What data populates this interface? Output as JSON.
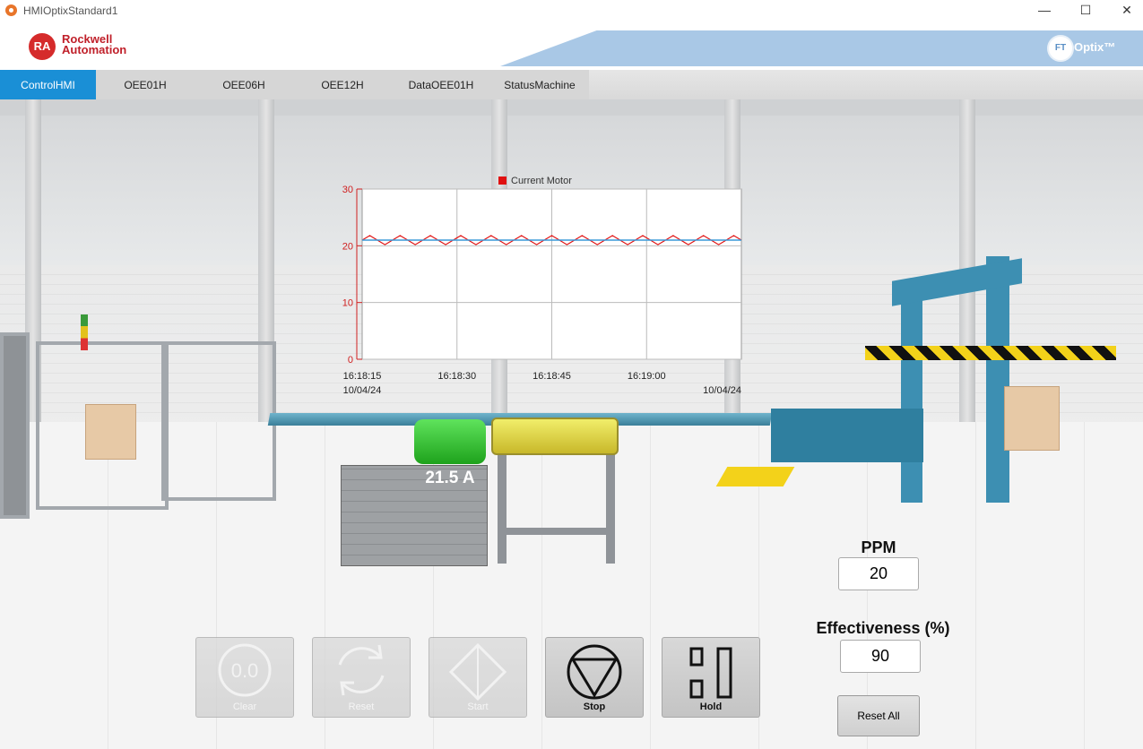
{
  "window": {
    "title": "HMIOptixStandard1",
    "minimize": "—",
    "maximize": "☐",
    "close": "✕"
  },
  "brand": {
    "logo_initials": "RA",
    "logo_line1": "Rockwell",
    "logo_line2": "Automation",
    "optix_badge": "FT",
    "optix_text": "Optix™"
  },
  "tabs": [
    "ControlHMI",
    "OEE01H",
    "OEE06H",
    "OEE12H",
    "DataOEE01H",
    "StatusMachine"
  ],
  "active_tab": "ControlHMI",
  "motor": {
    "current_display": "21.5 A"
  },
  "chart_data": {
    "type": "line",
    "legend": "Current Motor",
    "series": [
      {
        "name": "Current Motor",
        "color": "#e01010",
        "values": [
          21,
          21.8,
          21,
          20.2,
          21,
          21.8,
          21,
          20.2,
          21,
          21.8,
          21,
          20.2,
          21,
          21.8,
          21,
          20.2,
          21,
          21.8,
          21,
          20.2,
          21,
          21.8,
          21,
          20.2,
          21,
          21.8,
          21,
          20.2,
          21,
          21.8,
          21,
          20.2,
          21,
          21.8,
          21,
          20.2,
          21,
          21.8,
          21,
          20.2,
          21,
          21.8,
          21,
          20.2,
          21,
          21.8,
          21,
          20.2,
          21,
          21.8,
          21
        ]
      },
      {
        "name": "",
        "color": "#3a9ad9",
        "values": [
          21,
          21
        ]
      }
    ],
    "ylim": [
      0,
      30
    ],
    "yticks": [
      0,
      10,
      20,
      30
    ],
    "xticks": [
      "16:18:15",
      "16:18:30",
      "16:18:45",
      "16:19:00"
    ],
    "x_date_left": "10/04/24",
    "x_date_right": "10/04/24",
    "grid": true
  },
  "kpi": {
    "ppm_label": "PPM",
    "ppm_value": "20",
    "eff_label": "Effectiveness (%)",
    "eff_value": "90",
    "reset_all": "Reset All"
  },
  "controls": [
    {
      "label": "Clear",
      "icon": "clear-icon",
      "text": "0.0",
      "enabled": false
    },
    {
      "label": "Reset",
      "icon": "reset-icon",
      "enabled": false
    },
    {
      "label": "Start",
      "icon": "start-icon",
      "enabled": false
    },
    {
      "label": "Stop",
      "icon": "stop-icon",
      "enabled": true
    },
    {
      "label": "Hold",
      "icon": "hold-icon",
      "enabled": true
    }
  ]
}
